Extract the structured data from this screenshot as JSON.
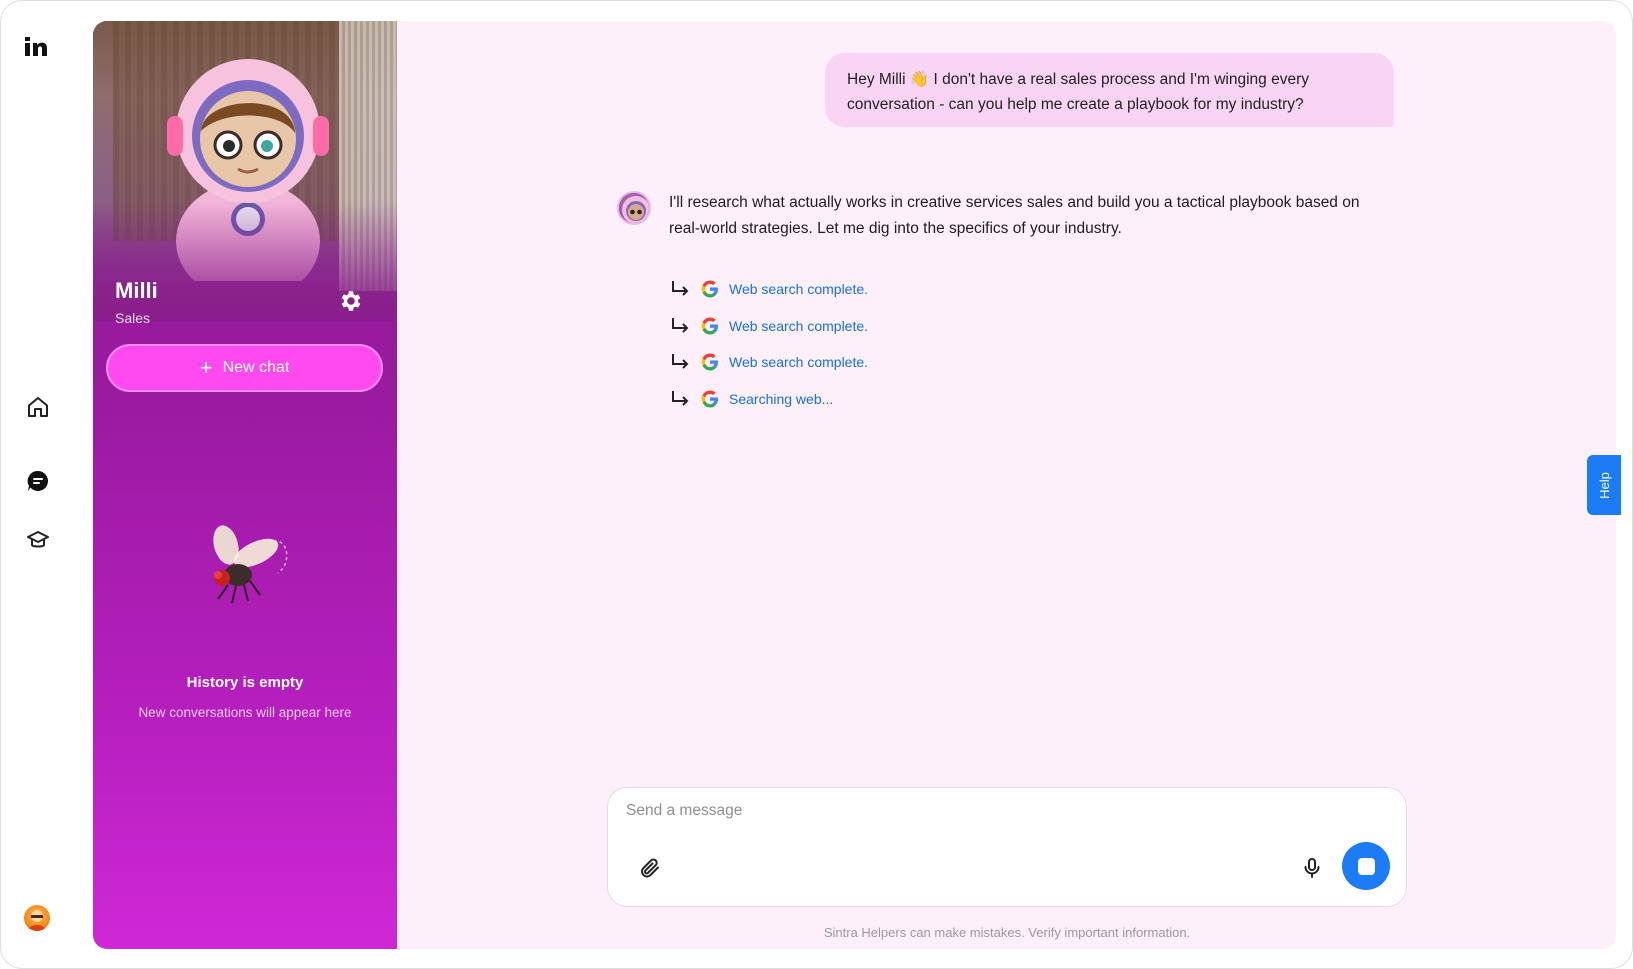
{
  "rail": {
    "logo_text": "in",
    "nav_items": [
      "home-icon",
      "chat-icon",
      "academy-icon"
    ]
  },
  "sidebar": {
    "agent_name": "Milli",
    "agent_role": "Sales",
    "new_chat_label": "New chat",
    "history_title": "History is empty",
    "history_subtitle": "New conversations will appear here"
  },
  "chat": {
    "user_message": "Hey Milli 👋 I don't have a real sales process and I'm winging every conversation - can you help me create a playbook for my industry?",
    "bot_message": "I'll research what actually works in creative services sales and build you a tactical playbook based on real-world strategies. Let me dig into the specifics of your industry.",
    "steps": [
      {
        "label": "Web search complete."
      },
      {
        "label": "Web search complete."
      },
      {
        "label": "Web search complete."
      },
      {
        "label": "Searching web..."
      }
    ]
  },
  "composer": {
    "placeholder": "Send a message",
    "disclaimer": "Sintra Helpers can make mistakes. Verify important information."
  },
  "help": {
    "label": "Help"
  },
  "colors": {
    "accent_pink": "#ff4af0",
    "accent_blue": "#1b7cf5",
    "sidebar_purple": "#9a1aa0",
    "main_bg": "#fdf0fb",
    "user_bubble": "#fad4f5"
  }
}
